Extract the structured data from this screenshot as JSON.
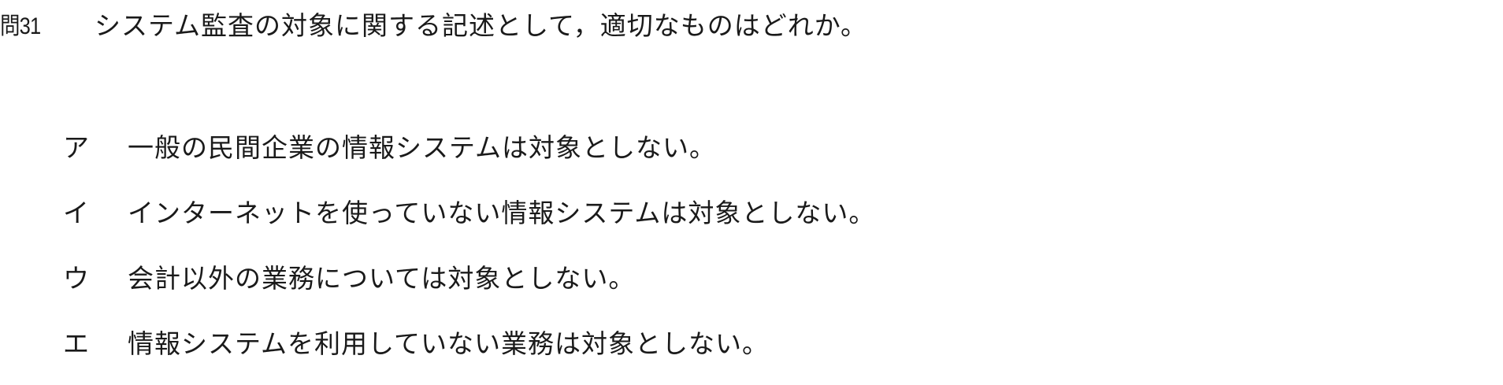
{
  "question": {
    "number": "問31",
    "text": "システム監査の対象に関する記述として，適切なものはどれか。"
  },
  "choices": [
    {
      "label": "ア",
      "text": "一般の民間企業の情報システムは対象としない。"
    },
    {
      "label": "イ",
      "text": "インターネットを使っていない情報システムは対象としない。"
    },
    {
      "label": "ウ",
      "text": "会計以外の業務については対象としない。"
    },
    {
      "label": "エ",
      "text": "情報システムを利用していない業務は対象としない。"
    }
  ]
}
